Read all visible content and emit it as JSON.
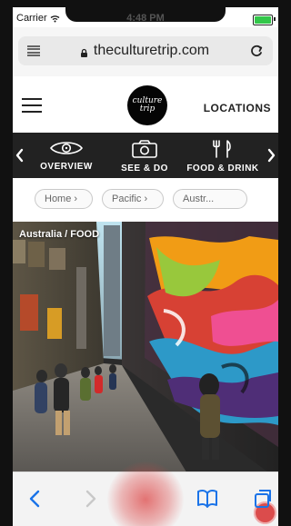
{
  "status_bar": {
    "carrier": "Carrier",
    "time": "4:48 PM"
  },
  "browser": {
    "url": "theculturetrip.com"
  },
  "site": {
    "logo_text": "culture trip",
    "locations_label": "LOCATIONS"
  },
  "categories": [
    {
      "label": "OVERVIEW",
      "icon": "eye-icon"
    },
    {
      "label": "SEE & DO",
      "icon": "camera-icon"
    },
    {
      "label": "FOOD & DRINK",
      "icon": "fork-knife-icon"
    }
  ],
  "breadcrumb": [
    "Home ›",
    "Pacific ›",
    "Austr..."
  ],
  "hero": {
    "label": "Australia / FOOD"
  },
  "toolbar": {
    "icons": [
      "back-icon",
      "forward-icon",
      "record-icon",
      "bookmarks-icon",
      "tabs-icon"
    ]
  },
  "colors": {
    "nav_background": "#222222",
    "accent_red": "#db4c4c"
  }
}
